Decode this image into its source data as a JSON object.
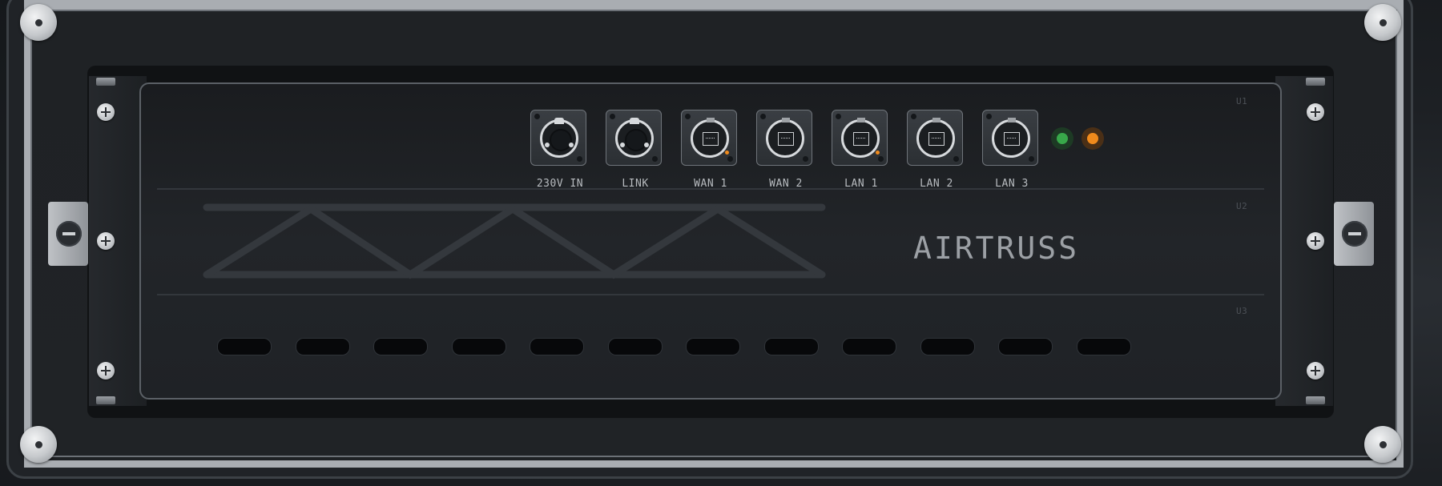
{
  "device": {
    "brand": "AIRTRUSS",
    "units": [
      "U1",
      "U2",
      "U3"
    ]
  },
  "ports": [
    {
      "id": "power-in",
      "label": "230V IN",
      "type": "powercon",
      "activity": false
    },
    {
      "id": "link",
      "label": "LINK",
      "type": "powercon",
      "activity": false
    },
    {
      "id": "wan1",
      "label": "WAN 1",
      "type": "rj45",
      "activity": true
    },
    {
      "id": "wan2",
      "label": "WAN 2",
      "type": "rj45",
      "activity": false
    },
    {
      "id": "lan1",
      "label": "LAN 1",
      "type": "rj45",
      "activity": true
    },
    {
      "id": "lan2",
      "label": "LAN 2",
      "type": "rj45",
      "activity": false
    },
    {
      "id": "lan3",
      "label": "LAN 3",
      "type": "rj45",
      "activity": false
    }
  ],
  "indicators": [
    {
      "name": "status",
      "color": "#38a84a"
    },
    {
      "name": "activity",
      "color": "#f08a1c"
    }
  ],
  "vent_count": 12,
  "colors": {
    "accent_orange": "#f08a1c",
    "status_green": "#38a84a",
    "rail_silver": "#a9adb2"
  }
}
